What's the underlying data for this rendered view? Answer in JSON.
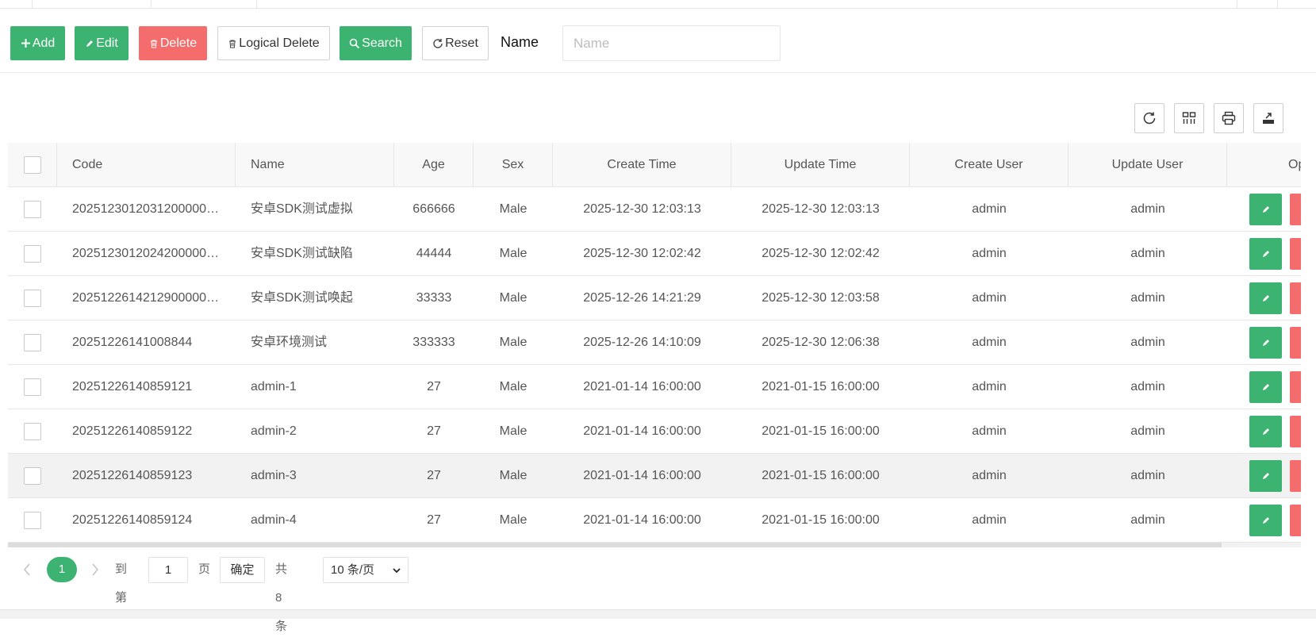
{
  "toolbar": {
    "add": "Add",
    "edit": "Edit",
    "delete": "Delete",
    "logical_delete": "Logical Delete",
    "search": "Search",
    "reset": "Reset",
    "name_label": "Name",
    "name_placeholder": "Name",
    "name_value": ""
  },
  "table": {
    "columns": [
      "Code",
      "Name",
      "Age",
      "Sex",
      "Create Time",
      "Update Time",
      "Create User",
      "Update User",
      "Operate"
    ],
    "column_header_visible": [
      "Code",
      "Name",
      "Age",
      "Sex",
      "Create Time",
      "Update Time",
      "Create User",
      "Update User",
      "Ope"
    ],
    "rows": [
      {
        "code": "2025123012031200000…",
        "name": "安卓SDK测试虚拟",
        "age": "666666",
        "sex": "Male",
        "create_time": "2025-12-30 12:03:13",
        "update_time": "2025-12-30 12:03:13",
        "create_user": "admin",
        "update_user": "admin"
      },
      {
        "code": "2025123012024200000…",
        "name": "安卓SDK测试缺陷",
        "age": "44444",
        "sex": "Male",
        "create_time": "2025-12-30 12:02:42",
        "update_time": "2025-12-30 12:02:42",
        "create_user": "admin",
        "update_user": "admin"
      },
      {
        "code": "2025122614212900000…",
        "name": "安卓SDK测试唤起",
        "age": "33333",
        "sex": "Male",
        "create_time": "2025-12-26 14:21:29",
        "update_time": "2025-12-30 12:03:58",
        "create_user": "admin",
        "update_user": "admin"
      },
      {
        "code": "20251226141008844",
        "name": "安卓环境测试",
        "age": "333333",
        "sex": "Male",
        "create_time": "2025-12-26 14:10:09",
        "update_time": "2025-12-30 12:06:38",
        "create_user": "admin",
        "update_user": "admin"
      },
      {
        "code": "20251226140859121",
        "name": "admin-1",
        "age": "27",
        "sex": "Male",
        "create_time": "2021-01-14 16:00:00",
        "update_time": "2021-01-15 16:00:00",
        "create_user": "admin",
        "update_user": "admin"
      },
      {
        "code": "20251226140859122",
        "name": "admin-2",
        "age": "27",
        "sex": "Male",
        "create_time": "2021-01-14 16:00:00",
        "update_time": "2021-01-15 16:00:00",
        "create_user": "admin",
        "update_user": "admin"
      },
      {
        "code": "20251226140859123",
        "name": "admin-3",
        "age": "27",
        "sex": "Male",
        "create_time": "2021-01-14 16:00:00",
        "update_time": "2021-01-15 16:00:00",
        "create_user": "admin",
        "update_user": "admin"
      },
      {
        "code": "20251226140859124",
        "name": "admin-4",
        "age": "27",
        "sex": "Male",
        "create_time": "2021-01-14 16:00:00",
        "update_time": "2021-01-15 16:00:00",
        "create_user": "admin",
        "update_user": "admin"
      }
    ]
  },
  "table_tools": [
    "refresh-icon",
    "columns-icon",
    "print-icon",
    "export-icon"
  ],
  "pager": {
    "current_page": "1",
    "goto_label": "到第",
    "goto_value": "1",
    "page_unit": "页",
    "confirm": "确定",
    "total": "共 8 条",
    "page_size": "10 条/页"
  },
  "colors": {
    "green": "#3cb371",
    "red": "#f56c6c",
    "border": "#e6e6e6"
  }
}
